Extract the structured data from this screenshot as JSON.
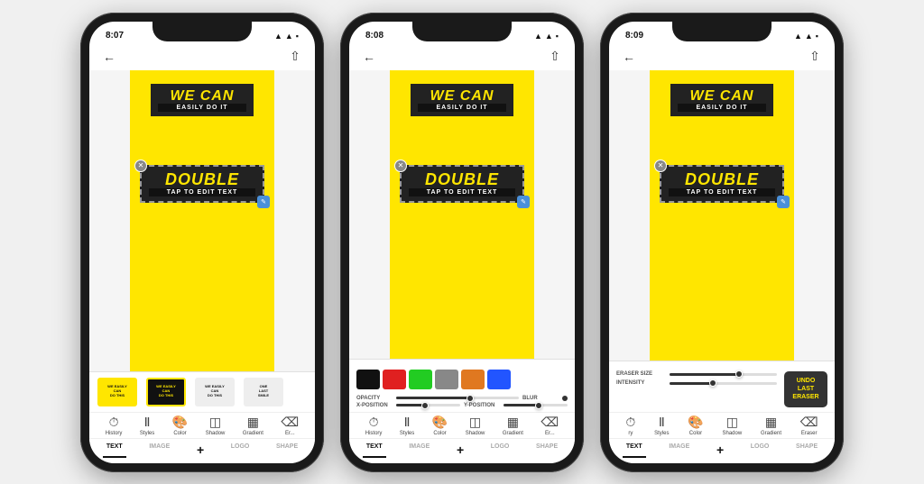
{
  "phones": [
    {
      "id": "phone1",
      "time": "8:07",
      "sticker_top": {
        "title": "WE CAN",
        "sub": "EASILY DO IT"
      },
      "sticker_bottom": {
        "title": "DOUBLE",
        "sub": "TAP TO EDIT TEXT"
      },
      "styles": [
        {
          "label": "WE EASILY\nCAN\nDO THIS",
          "type": "text-only"
        },
        {
          "label": "WE EASILY\nCAN\nDO THIS",
          "type": "black-box"
        },
        {
          "label": "WE EASILY\nCAN\nDO THIS",
          "type": "text-plain"
        },
        {
          "label": "ONE\nLAST\nSMILE",
          "type": "text-only"
        }
      ],
      "toolbar": [
        "History",
        "Styles",
        "Color",
        "Shadow",
        "Gradient",
        "Er..."
      ],
      "tabs": [
        "TEXT",
        "IMAGE",
        "+",
        "LOGO",
        "SHAPE"
      ],
      "active_tab": "TEXT"
    },
    {
      "id": "phone2",
      "time": "8:08",
      "sticker_top": {
        "title": "WE CAN",
        "sub": "EASILY DO IT"
      },
      "sticker_bottom": {
        "title": "DOUBLE",
        "sub": "TAP TO EDIT TEXT"
      },
      "swatches": [
        "#111111",
        "#e02020",
        "#22cc22",
        "#888888",
        "#e07820",
        "#2255ff"
      ],
      "controls": [
        {
          "label": "OPACITY",
          "fill": 60,
          "thumb": 60
        },
        {
          "label": "BLUR",
          "dot": true
        },
        {
          "label": "X-POSITION",
          "fill": 45,
          "thumb": 45
        },
        {
          "label": "Y-POSITION",
          "fill": 55,
          "thumb": 55
        }
      ],
      "toolbar": [
        "History",
        "Styles",
        "Color",
        "Shadow",
        "Gradient",
        "Er..."
      ],
      "tabs": [
        "TEXT",
        "IMAGE",
        "+",
        "LOGO",
        "SHAPE"
      ],
      "active_tab": "TEXT"
    },
    {
      "id": "phone3",
      "time": "8:09",
      "sticker_top": {
        "title": "WE CAN",
        "sub": "EASILY DO IT"
      },
      "sticker_bottom": {
        "title": "DOUBLE",
        "sub": "TAP TO EDIT TEXT"
      },
      "eraser": {
        "size_label": "ERASER SIZE",
        "intensity_label": "INTENSITY",
        "undo_label": "UNDO\nLAST\nERASER",
        "size_fill": 65,
        "intensity_fill": 40
      },
      "toolbar": [
        "ry",
        "Styles",
        "Color",
        "Shadow",
        "Gradient",
        "Eraser"
      ],
      "tabs": [
        "TEXT",
        "IMAGE",
        "+",
        "LOGO",
        "SHAPE"
      ],
      "active_tab": "TEXT"
    }
  ]
}
